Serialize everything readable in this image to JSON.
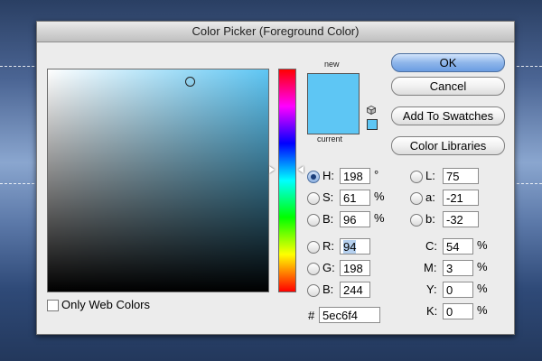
{
  "dialog": {
    "title": "Color Picker (Foreground Color)",
    "new_label": "new",
    "current_label": "current",
    "current_color": "#5ec6f4"
  },
  "buttons": {
    "ok": "OK",
    "cancel": "Cancel",
    "add_swatches": "Add To Swatches",
    "color_libraries": "Color Libraries"
  },
  "hsb": {
    "h": {
      "label": "H:",
      "value": "198",
      "unit": "°"
    },
    "s": {
      "label": "S:",
      "value": "61",
      "unit": "%"
    },
    "b": {
      "label": "B:",
      "value": "96",
      "unit": "%"
    }
  },
  "rgb": {
    "r": {
      "label": "R:",
      "value": "94"
    },
    "g": {
      "label": "G:",
      "value": "198"
    },
    "b": {
      "label": "B:",
      "value": "244"
    }
  },
  "lab": {
    "l": {
      "label": "L:",
      "value": "75"
    },
    "a": {
      "label": "a:",
      "value": "-21"
    },
    "b": {
      "label": "b:",
      "value": "-32"
    }
  },
  "cmyk": {
    "c": {
      "label": "C:",
      "value": "54",
      "unit": "%"
    },
    "m": {
      "label": "M:",
      "value": "3",
      "unit": "%"
    },
    "y": {
      "label": "Y:",
      "value": "0",
      "unit": "%"
    },
    "k": {
      "label": "K:",
      "value": "0",
      "unit": "%"
    }
  },
  "hex": {
    "label": "#",
    "value": "5ec6f4"
  },
  "web_colors": {
    "label": "Only Web Colors",
    "checked": false
  },
  "selected_mode": "H"
}
